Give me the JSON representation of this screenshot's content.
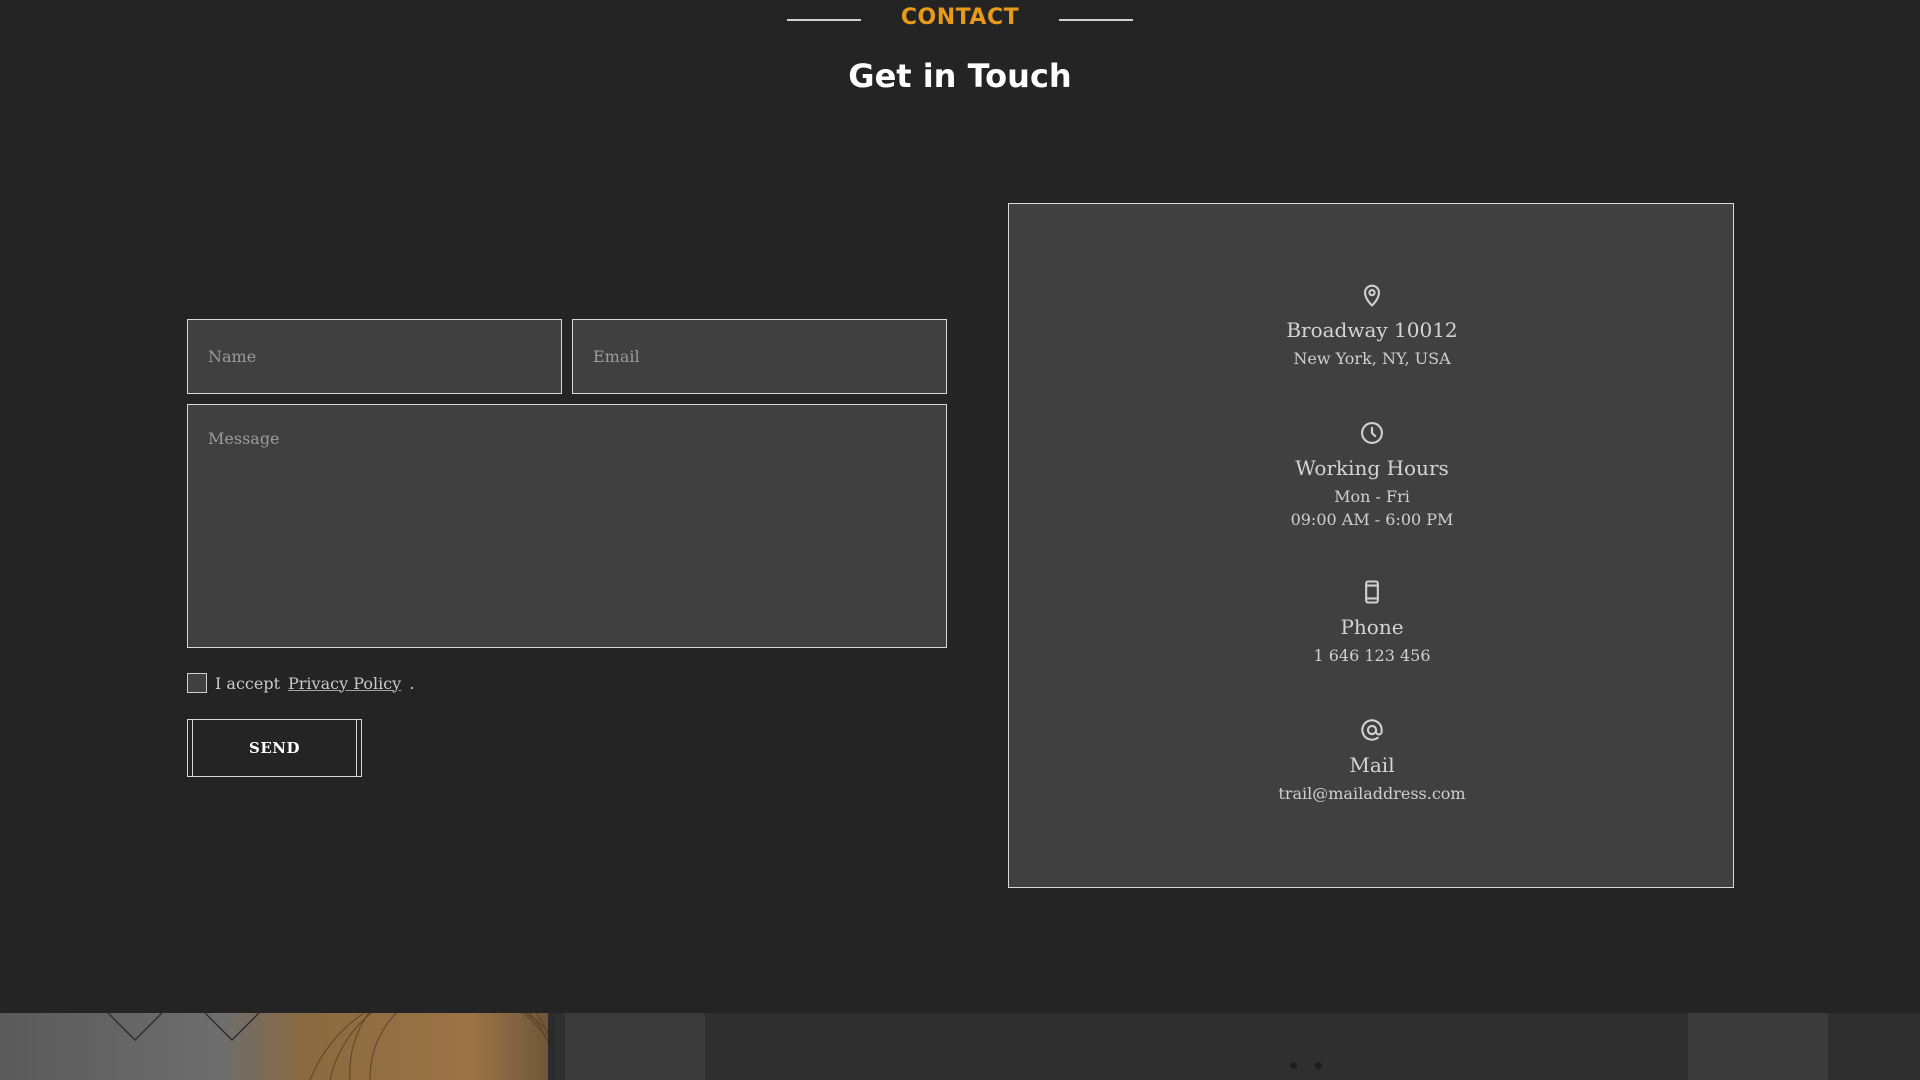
{
  "header": {
    "eyebrow": "CONTACT",
    "title": "Get in Touch"
  },
  "form": {
    "name_placeholder": "Name",
    "email_placeholder": "Email",
    "message_placeholder": "Message",
    "policy_prefix": "I accept",
    "policy_link": "Privacy Policy",
    "policy_suffix": ".",
    "send_label": "SEND"
  },
  "contact_info": {
    "address": {
      "icon": "map-pin-icon",
      "title": "Broadway 10012",
      "lines": [
        "New York, NY, USA"
      ]
    },
    "hours": {
      "icon": "clock-icon",
      "title": "Working Hours",
      "lines": [
        "Mon - Fri",
        "09:00 AM - 6:00 PM"
      ]
    },
    "phone": {
      "icon": "phone-icon",
      "title": "Phone",
      "lines": [
        "1 646 123 456"
      ]
    },
    "mail": {
      "icon": "at-sign-icon",
      "title": "Mail",
      "lines": [
        "trail@mailaddress.com"
      ]
    }
  },
  "colors": {
    "background": "#242424",
    "panel": "#404040",
    "accent": "#e89a1b",
    "border": "#d8d8d8",
    "text": "#d4d4d4"
  }
}
